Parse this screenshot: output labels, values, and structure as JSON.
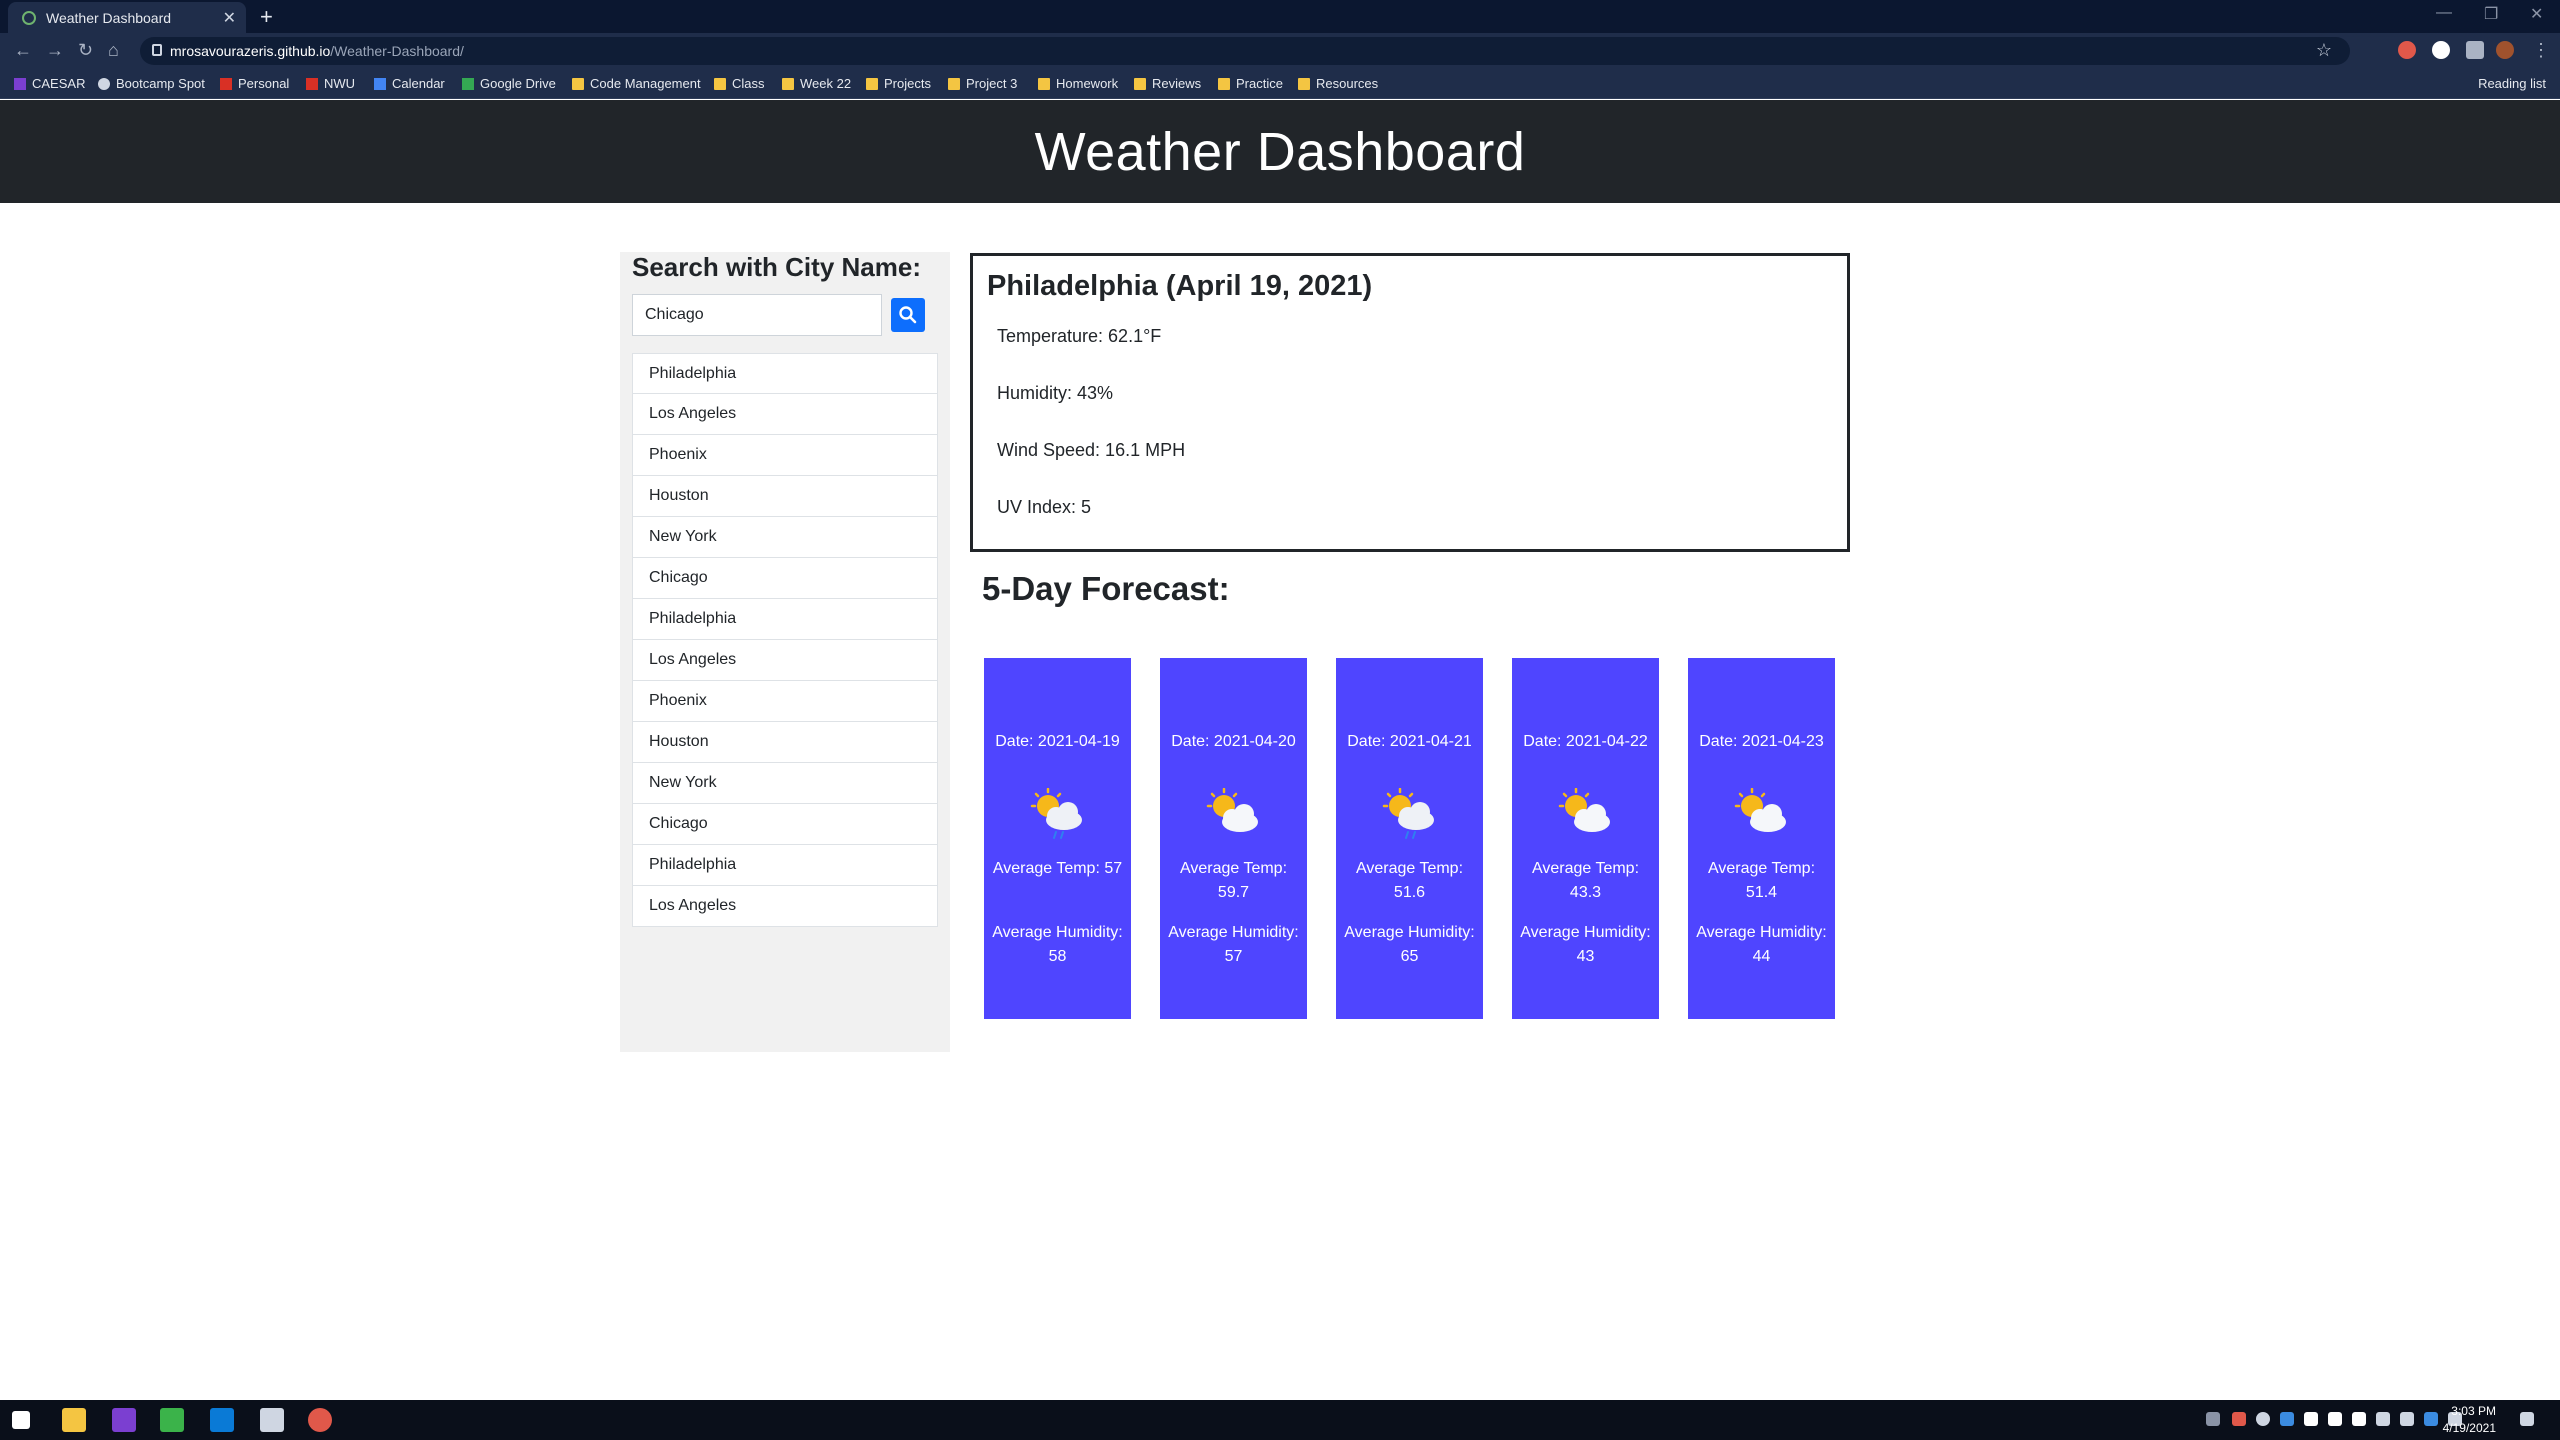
{
  "browser": {
    "tab_title": "Weather Dashboard",
    "new_tab": "+",
    "url_host": "mrosavourazeris.github.io",
    "url_path": "/Weather-Dashboard/",
    "reading_list": "Reading list",
    "bookmarks": [
      "CAESAR",
      "Bootcamp Spot",
      "Personal",
      "NWU",
      "Calendar",
      "Google Drive",
      "Code Management",
      "Class",
      "Week 22",
      "Projects",
      "Project 3",
      "Homework",
      "Reviews",
      "Practice",
      "Resources"
    ]
  },
  "header": {
    "title": "Weather Dashboard"
  },
  "search": {
    "title": "Search with City Name:",
    "value": "Chicago",
    "history": [
      "Philadelphia",
      "Los Angeles",
      "Phoenix",
      "Houston",
      "New York",
      "Chicago",
      "Philadelphia",
      "Los Angeles",
      "Phoenix",
      "Houston",
      "New York",
      "Chicago",
      "Philadelphia",
      "Los Angeles"
    ]
  },
  "current": {
    "title": "Philadelphia (April 19, 2021)",
    "temperature": "Temperature: 62.1°F",
    "humidity": "Humidity: 43%",
    "wind": "Wind Speed: 16.1 MPH",
    "uv": "UV Index: 5"
  },
  "forecast": {
    "title": "5-Day Forecast:",
    "days": [
      {
        "date": "Date: 2021-04-19",
        "icon": "sun-cloud-rain-icon",
        "temp": "Average Temp: 57",
        "humidity": "Average Humidity: 58"
      },
      {
        "date": "Date: 2021-04-20",
        "icon": "sun-cloud-icon",
        "temp": "Average Temp: 59.7",
        "humidity": "Average Humidity: 57"
      },
      {
        "date": "Date: 2021-04-21",
        "icon": "sun-cloud-rain-icon",
        "temp": "Average Temp: 51.6",
        "humidity": "Average Humidity: 65"
      },
      {
        "date": "Date: 2021-04-22",
        "icon": "sun-cloud-icon",
        "temp": "Average Temp: 43.3",
        "humidity": "Average Humidity: 43"
      },
      {
        "date": "Date: 2021-04-23",
        "icon": "sun-cloud-icon",
        "temp": "Average Temp: 51.4",
        "humidity": "Average Humidity: 44"
      }
    ]
  },
  "taskbar": {
    "time": "3:03 PM",
    "date": "4/19/2021"
  },
  "colors": {
    "header_bg": "#212529",
    "card_bg": "#4f45ff",
    "search_btn": "#0d6efd"
  }
}
